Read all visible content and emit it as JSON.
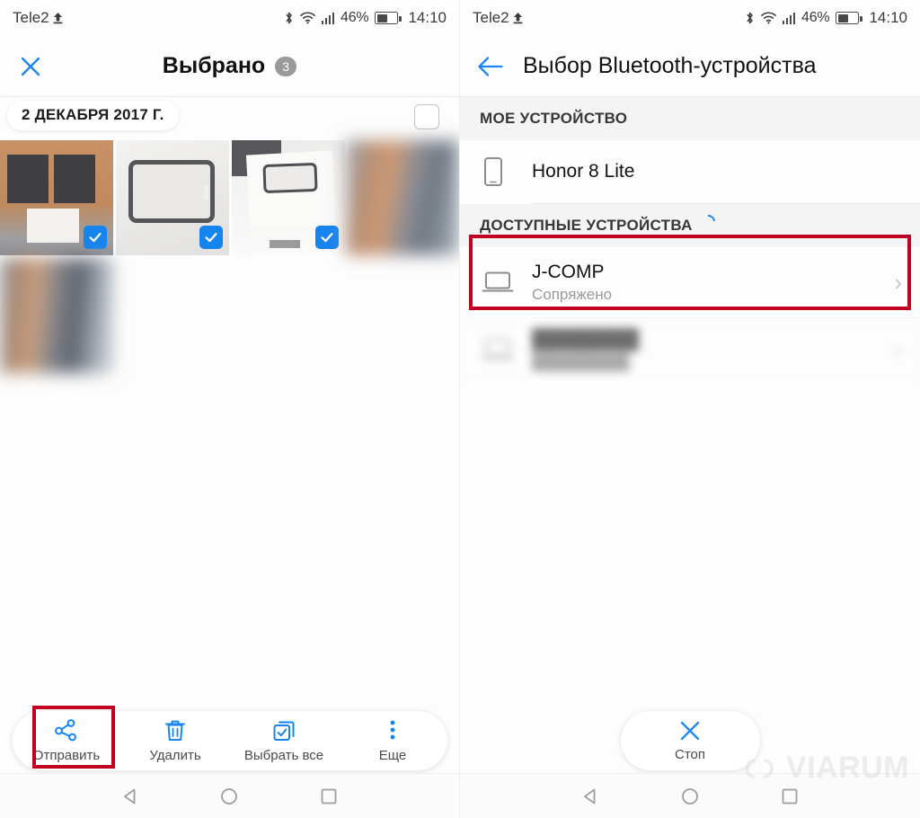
{
  "status_bar": {
    "carrier": "Tele2",
    "battery_percent": "46%",
    "time": "14:10",
    "icons": [
      "upload-arrow-icon",
      "bluetooth-icon",
      "wifi-icon",
      "signal-bars-icon",
      "battery-icon"
    ]
  },
  "left_panel": {
    "appbar": {
      "close_icon": "close-icon",
      "title": "Выбрано",
      "count": "3"
    },
    "gallery": {
      "date_label": "2 ДЕКАБРЯ 2017 Г.",
      "select_all_checkbox_checked": false,
      "thumbnails": [
        {
          "id": "thumb-1",
          "selected": true,
          "blurred": false
        },
        {
          "id": "thumb-2",
          "selected": true,
          "blurred": false
        },
        {
          "id": "thumb-3",
          "selected": true,
          "blurred": false
        },
        {
          "id": "thumb-4",
          "selected": false,
          "blurred": true
        },
        {
          "id": "thumb-5",
          "selected": false,
          "blurred": true
        }
      ]
    },
    "toolbar": {
      "items": [
        {
          "label": "Отправить",
          "icon": "share-nodes-icon",
          "highlighted": true
        },
        {
          "label": "Удалить",
          "icon": "trash-icon",
          "highlighted": false
        },
        {
          "label": "Выбрать все",
          "icon": "select-all-icon",
          "highlighted": false
        },
        {
          "label": "Еще",
          "icon": "more-vertical-icon",
          "highlighted": false
        }
      ]
    }
  },
  "right_panel": {
    "appbar": {
      "back_icon": "arrow-left-icon",
      "title": "Выбор Bluetooth-устройства"
    },
    "sections": [
      {
        "header": "МОЕ УСТРОЙСТВО",
        "has_spinner": false,
        "devices": [
          {
            "name": "Honor 8 Lite",
            "sub": "",
            "icon": "phone-icon",
            "chevron": false,
            "highlighted": false,
            "blurred": false
          }
        ]
      },
      {
        "header": "ДОСТУПНЫЕ УСТРОЙСТВА",
        "has_spinner": true,
        "devices": [
          {
            "name": "J-COMP",
            "sub": "Сопряжено",
            "icon": "laptop-icon",
            "chevron": true,
            "highlighted": true,
            "blurred": false
          },
          {
            "name": "",
            "sub": "",
            "icon": "laptop-icon",
            "chevron": true,
            "highlighted": false,
            "blurred": true
          }
        ]
      }
    ],
    "stop_button": {
      "label": "Стоп",
      "icon": "close-icon"
    }
  },
  "nav_bar": {
    "items": [
      {
        "name": "back-nav-button",
        "icon": "triangle-left-icon"
      },
      {
        "name": "home-nav-button",
        "icon": "circle-icon"
      },
      {
        "name": "recents-nav-button",
        "icon": "square-icon"
      }
    ]
  },
  "watermark": {
    "text": "VIARUM",
    "logo_icon": "viarum-logo-icon"
  },
  "colors": {
    "accent_blue": "#1684ef",
    "highlight_red": "#c2001f",
    "badge_gray": "#9a9a9a",
    "section_bg": "#f4f4f4"
  }
}
